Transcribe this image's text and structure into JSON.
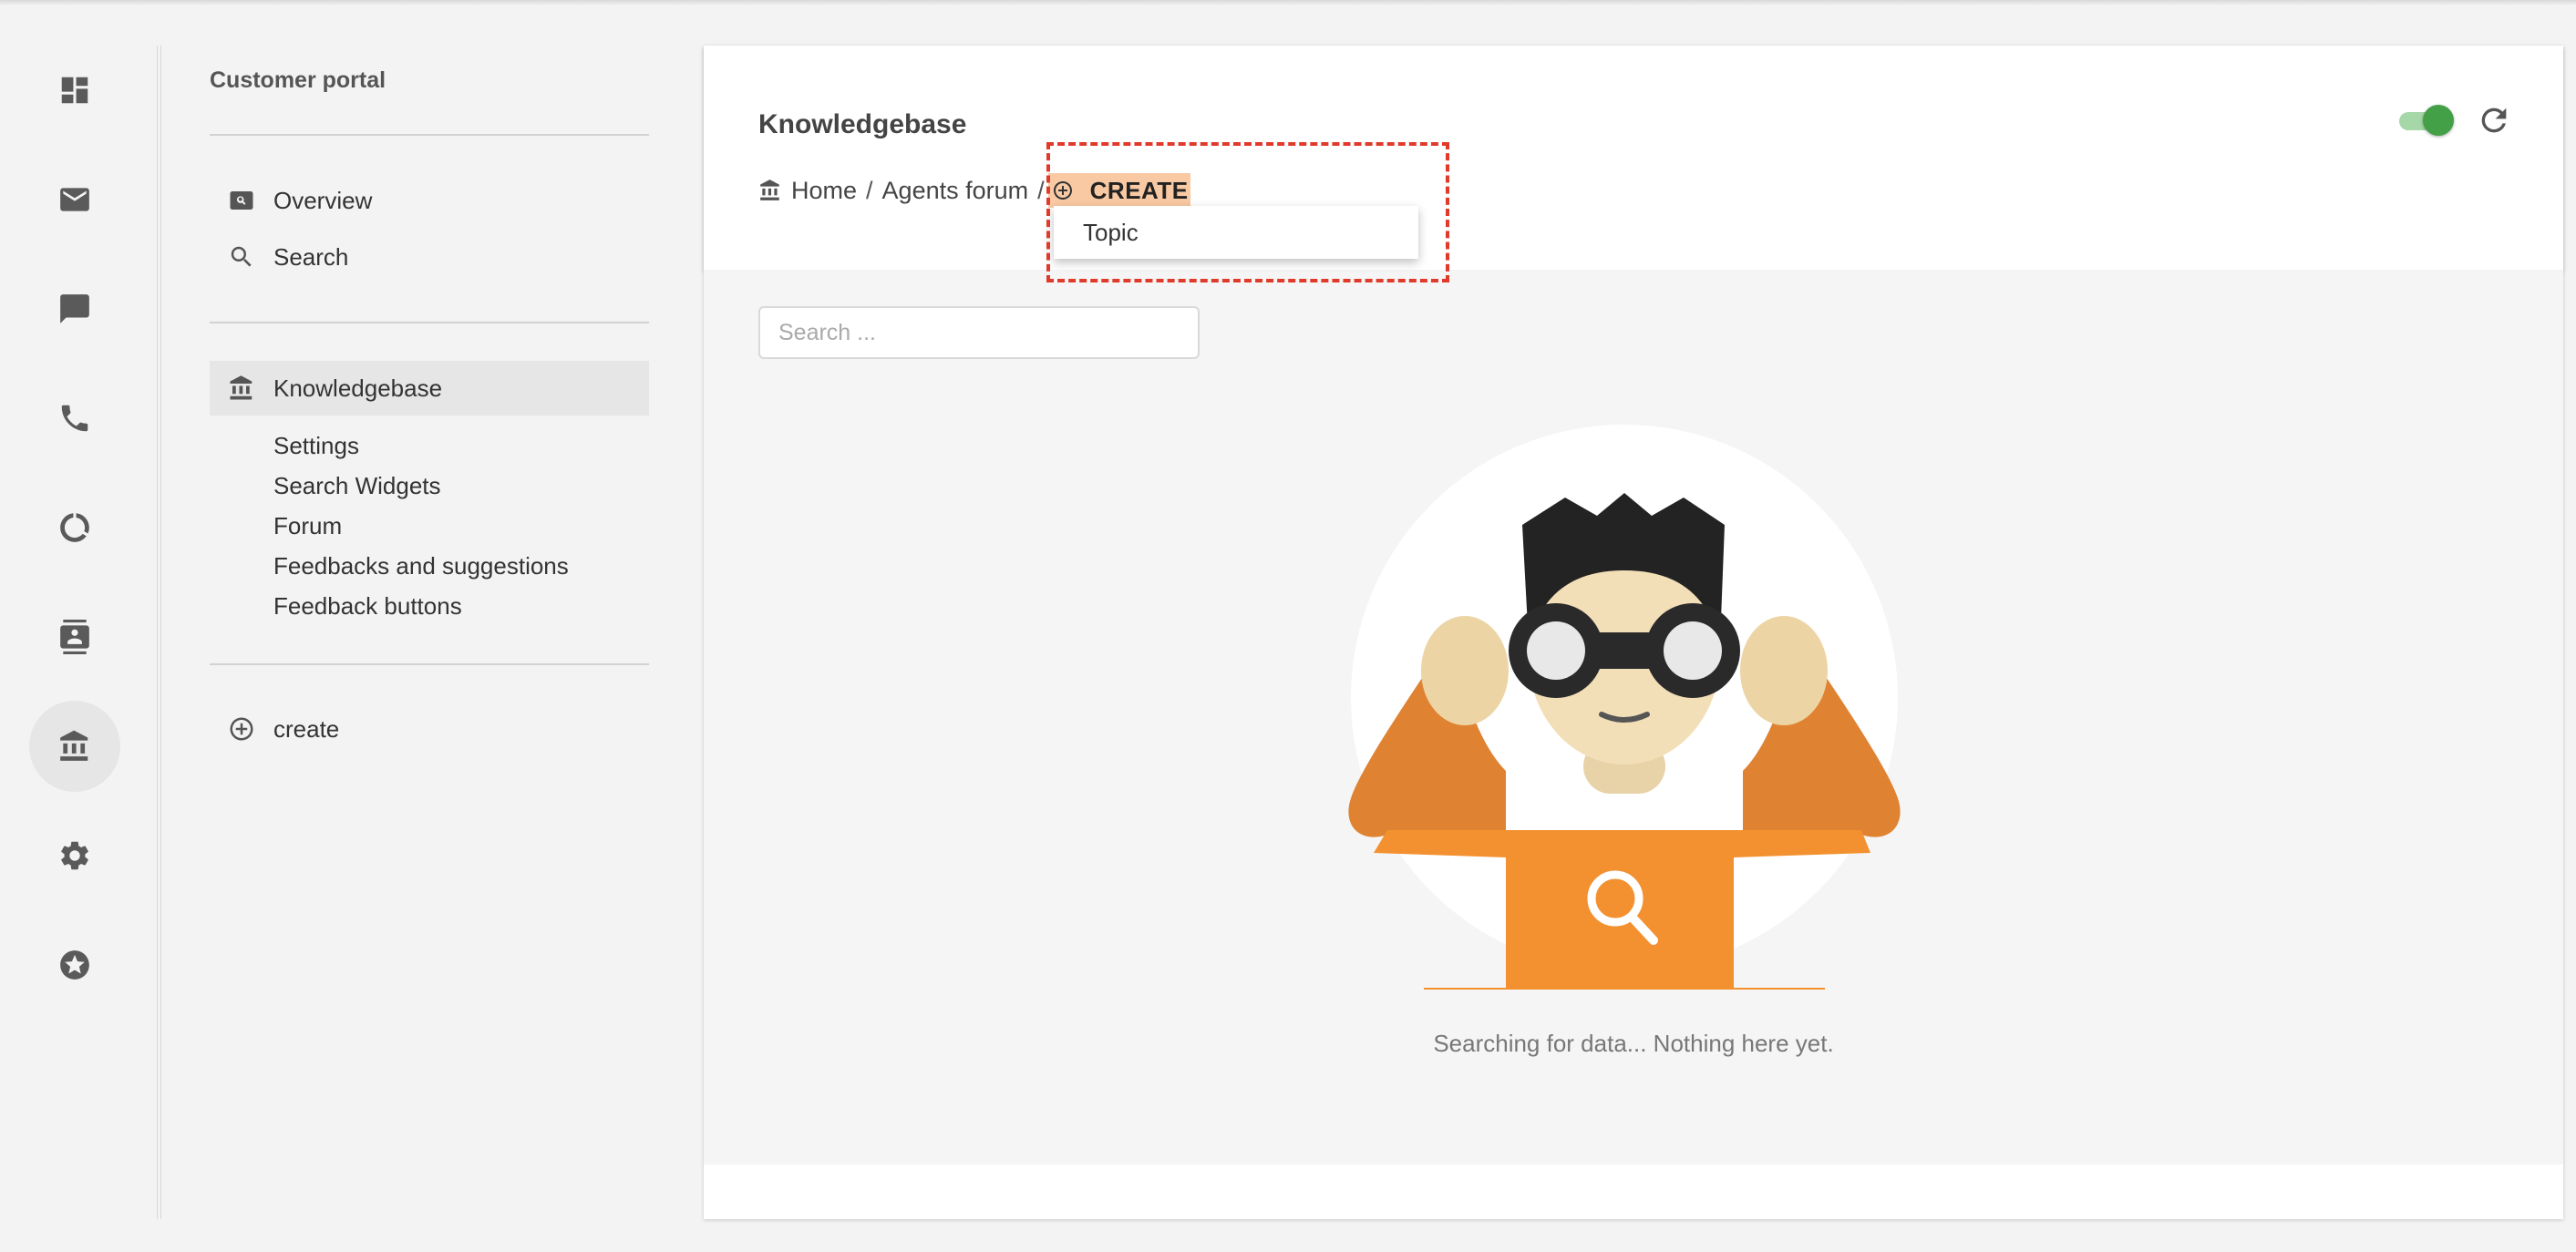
{
  "rail": {
    "items": [
      {
        "name": "dashboard-icon",
        "active": false
      },
      {
        "name": "mail-icon",
        "active": false
      },
      {
        "name": "chat-icon",
        "active": false
      },
      {
        "name": "phone-icon",
        "active": false
      },
      {
        "name": "report-icon",
        "active": false
      },
      {
        "name": "contacts-icon",
        "active": false
      },
      {
        "name": "bank-icon",
        "active": true
      },
      {
        "name": "gear-icon",
        "active": false
      },
      {
        "name": "star-icon",
        "active": false
      }
    ]
  },
  "sidebar": {
    "title": "Customer portal",
    "items": [
      {
        "label": "Overview",
        "icon": "overview-icon"
      },
      {
        "label": "Search",
        "icon": "search-icon"
      },
      {
        "label": "Knowledgebase",
        "icon": "bank-icon",
        "active": true
      }
    ],
    "subitems": [
      "Settings",
      "Search Widgets",
      "Forum",
      "Feedbacks and suggestions",
      "Feedback buttons"
    ],
    "create_label": "create"
  },
  "header": {
    "title": "Knowledgebase",
    "breadcrumb": {
      "home": "Home",
      "sep": "/",
      "forum": "Agents forum",
      "create": "CREATE"
    },
    "dropdown_item": "Topic",
    "toggle_on": true
  },
  "content": {
    "search_placeholder": "Search ...",
    "empty_message": "Searching for data... Nothing here yet."
  },
  "colors": {
    "accent_orange": "#f39130",
    "toggle_green": "#43a047",
    "highlight": "#f9c9a3",
    "dash_red": "#e03a2a"
  }
}
